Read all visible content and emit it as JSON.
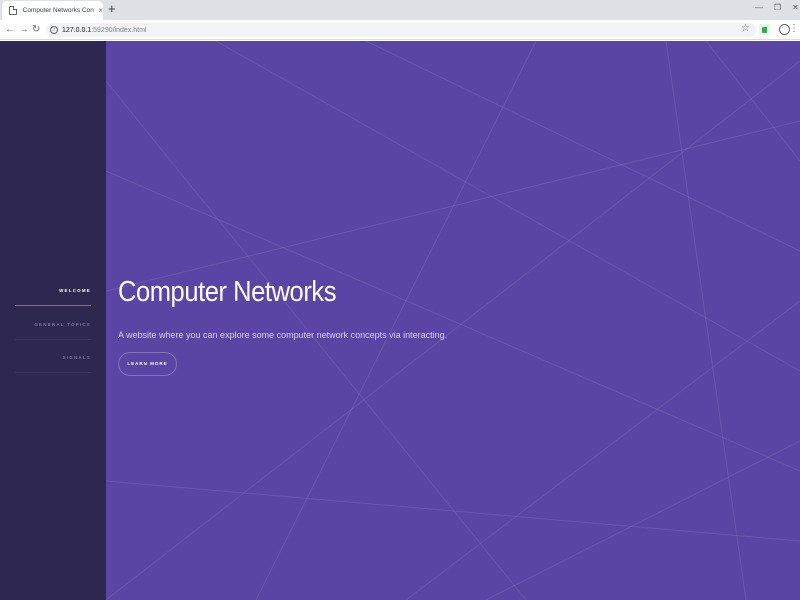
{
  "browser": {
    "tab_title": "Computer Networks Concepts",
    "tab_close": "×",
    "new_tab": "+",
    "url_host": "127.0.0.1",
    "url_rest": ":59290/index.html",
    "window_controls": [
      "—",
      "❐",
      "✕"
    ],
    "nav": {
      "back": "←",
      "forward": "→",
      "reload": "↻"
    },
    "star": "☆",
    "menu": "⋮",
    "info": "i"
  },
  "sidebar": {
    "items": [
      {
        "label": "WELCOME",
        "active": true
      },
      {
        "label": "GENERAL TOPICS",
        "active": false
      },
      {
        "label": "SIGNALS",
        "active": false
      }
    ]
  },
  "hero": {
    "title": "Computer Networks",
    "subtitle": "A website where you can explore some computer network concepts via interacting.",
    "button_label": "LEARN MORE"
  },
  "colors": {
    "sidebar_bg": "#2e2850",
    "main_bg": "#5b45a4",
    "active_underline": "#7c63c9",
    "text_active": "#ffffff",
    "text_inactive": "#7b7499"
  }
}
